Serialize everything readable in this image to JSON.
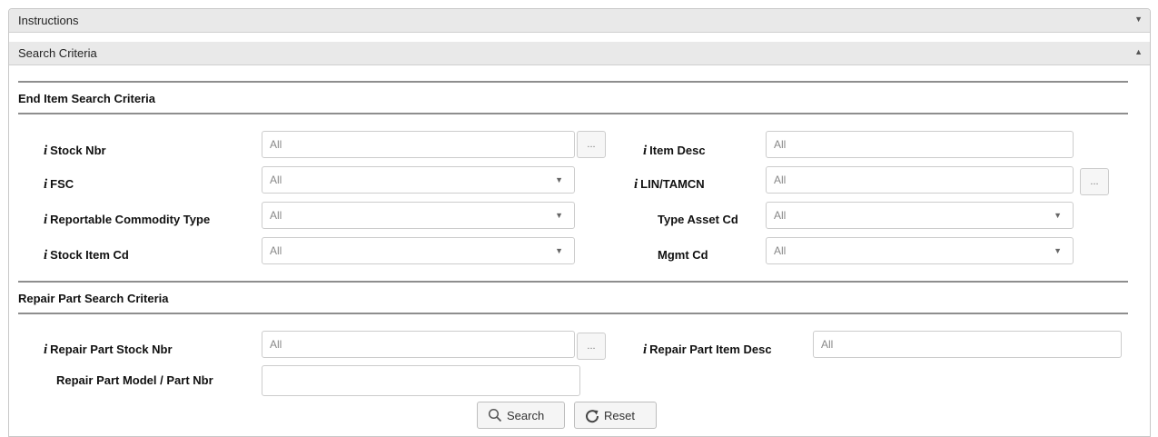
{
  "accordion": {
    "instructions": {
      "label": "Instructions",
      "arrow": "▼"
    },
    "search_criteria": {
      "label": "Search Criteria",
      "arrow": "▲"
    }
  },
  "info_glyph": "i",
  "ellipsis": "...",
  "dropdown_arrow": "▼",
  "end_item": {
    "title": "End Item Search Criteria",
    "fields": {
      "stock_nbr": {
        "label": "Stock Nbr",
        "placeholder": "All"
      },
      "fsc": {
        "label": "FSC",
        "placeholder": "All"
      },
      "reportable_commodity_type": {
        "label": "Reportable Commodity Type",
        "placeholder": "All"
      },
      "stock_item_cd": {
        "label": "Stock Item Cd",
        "placeholder": "All"
      },
      "item_desc": {
        "label": "Item Desc",
        "placeholder": "All"
      },
      "lin_tamcn": {
        "label": "LIN/TAMCN",
        "placeholder": "All"
      },
      "type_asset_cd": {
        "label": "Type Asset Cd",
        "placeholder": "All"
      },
      "mgmt_cd": {
        "label": "Mgmt Cd",
        "placeholder": "All"
      }
    }
  },
  "repair_part": {
    "title": "Repair Part Search Criteria",
    "fields": {
      "stock_nbr": {
        "label": "Repair Part Stock Nbr",
        "placeholder": "All"
      },
      "item_desc": {
        "label": "Repair Part Item Desc",
        "placeholder": "All"
      },
      "model_part_nbr": {
        "label": "Repair Part Model / Part Nbr",
        "value": ""
      }
    }
  },
  "buttons": {
    "search": {
      "label": "Search",
      "icon": "search-icon"
    },
    "reset": {
      "label": "Reset",
      "icon": "reset-icon"
    }
  }
}
